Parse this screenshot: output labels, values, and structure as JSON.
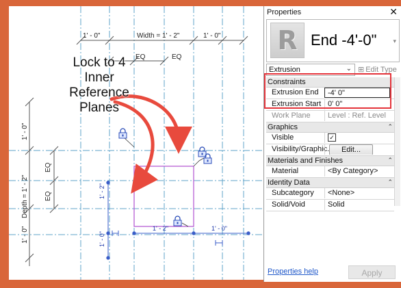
{
  "canvas": {
    "dims": {
      "top_left": "1' - 0\"",
      "width": "Width = 1' - 2\"",
      "top_right": "1' - 0\"",
      "eq_top_a": "EQ",
      "eq_top_b": "EQ",
      "left_top": "1' - 0\"",
      "depth": "Depth = 1' - 2\"",
      "eq_left_a": "EQ",
      "eq_left_b": "EQ",
      "left_bottom": "1' - 0\"",
      "temp_vertical_a": "1' - 2\"",
      "temp_vertical_b": "1' - 0\"",
      "temp_bottom_a": "1' - 2\"",
      "temp_bottom_b": "1' - 0\""
    },
    "callout": [
      "Lock to 4",
      "Inner",
      "Reference",
      "Planes"
    ],
    "colors": {
      "reference_plane": "#4a90b8",
      "extrusion": "#b04fd0",
      "arrow": "#e84a3d",
      "temp_dimension": "#1a35a8"
    }
  },
  "properties": {
    "title": "Properties",
    "close_symbol": "✕",
    "type_name": "End -4'-0\"",
    "type_dropdown_symbol": "▾",
    "logo_letter": "R",
    "selector_value": "Extrusion",
    "edit_type_label": "Edit Type",
    "sections": [
      {
        "label": "Constraints",
        "rows": [
          {
            "label": "Extrusion End",
            "value": "-4'  0\""
          },
          {
            "label": "Extrusion Start",
            "value": "0'  0\""
          },
          {
            "label": "Work Plane",
            "value": "Level : Ref. Level"
          }
        ]
      },
      {
        "label": "Graphics",
        "rows": [
          {
            "label": "Visible",
            "value": "✓"
          },
          {
            "label": "Visibility/Graphic...",
            "value": "Edit..."
          }
        ]
      },
      {
        "label": "Materials and Finishes",
        "rows": [
          {
            "label": "Material",
            "value": "<By Category>"
          }
        ]
      },
      {
        "label": "Identity Data",
        "rows": [
          {
            "label": "Subcategory",
            "value": "<None>"
          },
          {
            "label": "Solid/Void",
            "value": "Solid"
          }
        ]
      }
    ],
    "help_link": "Properties help",
    "apply_label": "Apply"
  }
}
